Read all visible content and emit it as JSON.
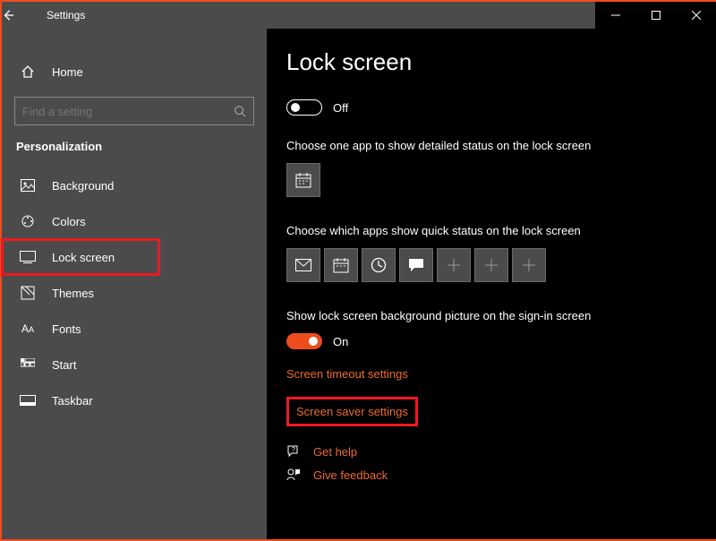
{
  "window": {
    "title": "Settings"
  },
  "sidebar": {
    "home": "Home",
    "search_placeholder": "Find a setting",
    "section": "Personalization",
    "items": [
      {
        "label": "Background"
      },
      {
        "label": "Colors"
      },
      {
        "label": "Lock screen"
      },
      {
        "label": "Themes"
      },
      {
        "label": "Fonts"
      },
      {
        "label": "Start"
      },
      {
        "label": "Taskbar"
      }
    ]
  },
  "content": {
    "title": "Lock screen",
    "toggle1_state": "Off",
    "detailed_status_label": "Choose one app to show detailed status on the lock screen",
    "quick_status_label": "Choose which apps show quick status on the lock screen",
    "signin_label": "Show lock screen background picture on the sign-in screen",
    "toggle2_state": "On",
    "link_timeout": "Screen timeout settings",
    "link_saver": "Screen saver settings",
    "help": "Get help",
    "feedback": "Give feedback"
  }
}
